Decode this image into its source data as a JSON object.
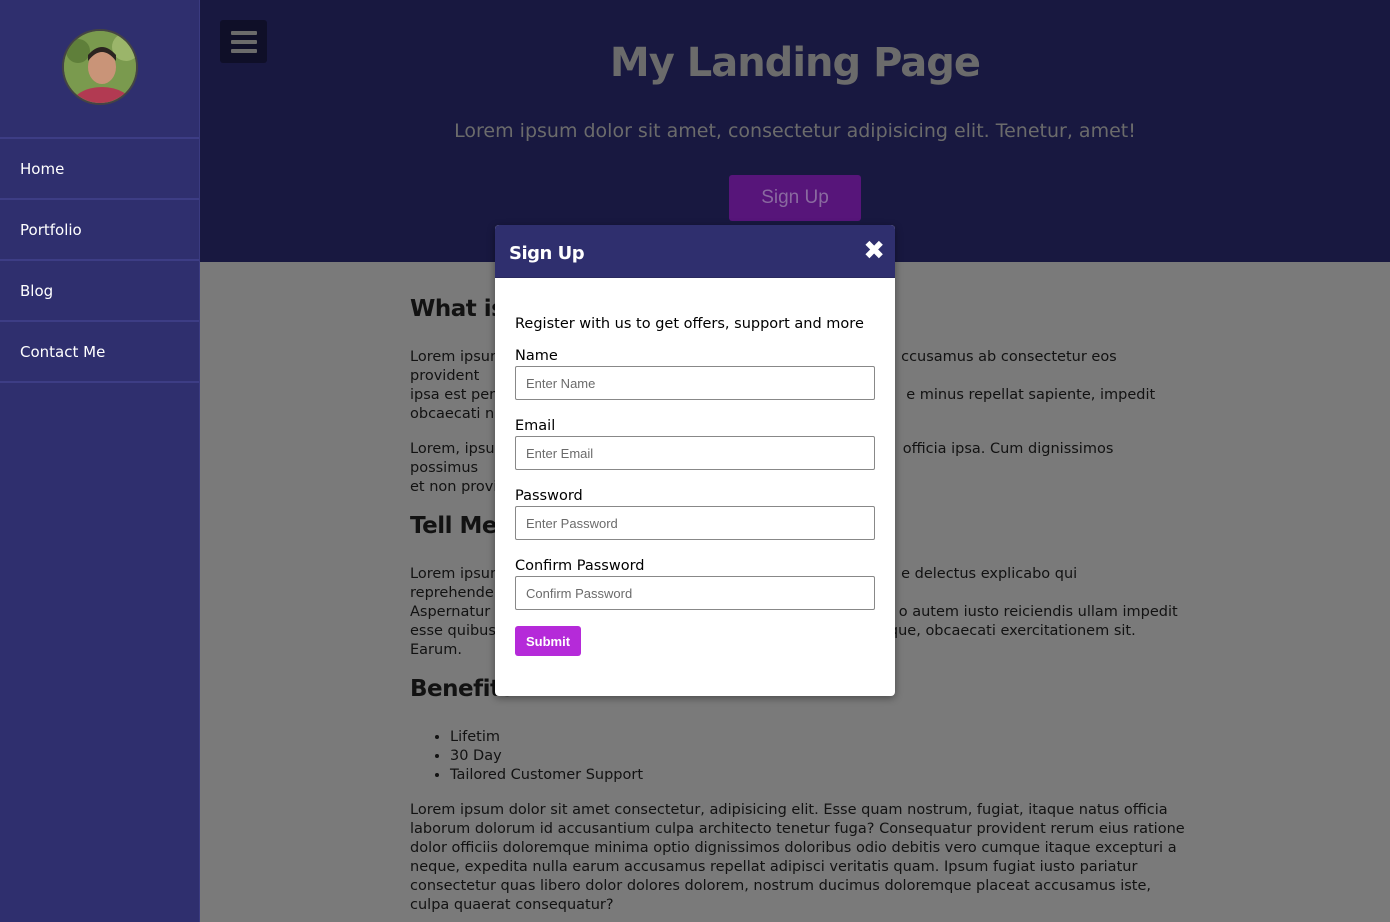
{
  "sidebar": {
    "items": [
      {
        "label": "Home"
      },
      {
        "label": "Portfolio"
      },
      {
        "label": "Blog"
      },
      {
        "label": "Contact Me"
      }
    ]
  },
  "hero": {
    "title": "My Landing Page",
    "subtitle": "Lorem ipsum dolor sit amet, consectetur adipisicing elit. Tenetur, amet!",
    "signup_label": "Sign Up"
  },
  "content": {
    "heading1": "What is",
    "para1_left": "Lorem ipsum",
    "para1_right": "ccusamus ab consectetur eos provident",
    "para1_l2_left": "ipsa est perf",
    "para1_l2_right": "e minus repellat sapiente, impedit",
    "para1_l3_left": "obcaecati ne",
    "para2_left": "Lorem, ipsum",
    "para2_right": "officia ipsa. Cum dignissimos possimus",
    "para2_l2_left": "et non provi",
    "heading2": "Tell Me I",
    "para3_l1_left": "Lorem ipsum",
    "para3_l1_right": "e delectus explicabo qui reprehenderit?",
    "para3_l2_left": "Aspernatur a",
    "para3_l2_right": "o autem iusto reiciendis ullam impedit",
    "para3_l3_left": "esse quibusc",
    "para3_l3_right": "que, obcaecati exercitationem sit. Earum.",
    "heading3": "Benefits",
    "benefits": [
      "Lifetim",
      "30 Day",
      "Tailored Customer Support"
    ],
    "para4": "Lorem ipsum dolor sit amet consectetur, adipisicing elit. Esse quam nostrum, fugiat, itaque natus officia laborum dolorum id accusantium culpa architecto tenetur fuga? Consequatur provident rerum eius ratione dolor officiis doloremque minima optio dignissimos doloribus odio debitis vero cumque itaque excepturi a neque, expedita nulla earum accusamus repellat adipisci veritatis quam. Ipsum fugiat iusto pariatur consectetur quas libero dolor dolores dolorem, nostrum ducimus doloremque placeat accusamus iste, culpa quaerat consequatur?"
  },
  "modal": {
    "title": "Sign Up",
    "close_glyph": "✖",
    "intro": "Register with us to get offers, support and more",
    "fields": [
      {
        "label": "Name",
        "placeholder": "Enter Name"
      },
      {
        "label": "Email",
        "placeholder": "Enter Email"
      },
      {
        "label": "Password",
        "placeholder": "Enter Password"
      },
      {
        "label": "Confirm Password",
        "placeholder": "Confirm Password"
      }
    ],
    "submit_label": "Submit"
  },
  "colors": {
    "sidebar_bg": "#2f2f6e",
    "accent": "#b52ad9"
  }
}
